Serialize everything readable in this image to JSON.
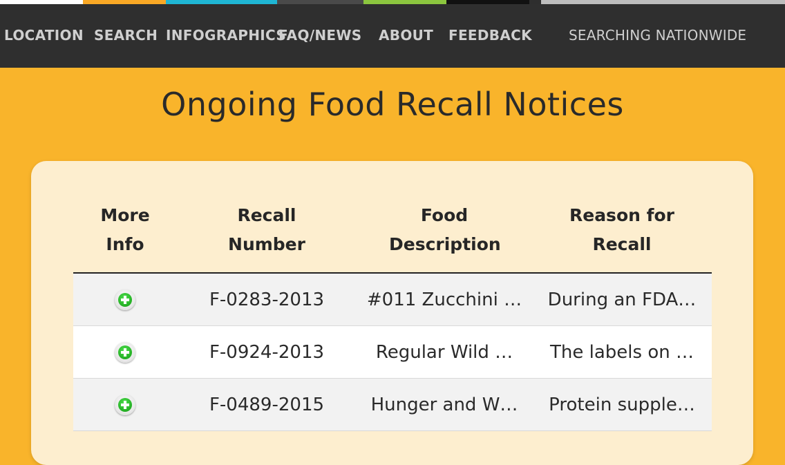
{
  "nav": {
    "location": "LOCATION",
    "search": "SEARCH",
    "infographics": "INFOGRAPHICS",
    "faq_news": "FAQ/NEWS",
    "about": "ABOUT",
    "feedback": "FEEDBACK",
    "search_status": "SEARCHING NATIONWIDE"
  },
  "accent_colors": [
    "#ffffff",
    "#f9a825",
    "#1fb6d4",
    "#4a4a4a",
    "#8cc63f",
    "#111111",
    "#2e2e2e",
    "#bdbdbd"
  ],
  "page": {
    "title": "Ongoing Food Recall Notices"
  },
  "table": {
    "headers": {
      "more_info": "More Info",
      "recall_number": "Recall Number",
      "food_description": "Food Description",
      "reason": "Reason for Recall"
    },
    "rows": [
      {
        "icon": "plus-circle-icon",
        "recall_number": "F-0283-2013",
        "food_description": "#011 Zucchini …",
        "reason": "During an FDA…"
      },
      {
        "icon": "plus-circle-icon",
        "recall_number": "F-0924-2013",
        "food_description": "Regular Wild …",
        "reason": "The labels on …"
      },
      {
        "icon": "plus-circle-icon",
        "recall_number": "F-0489-2015",
        "food_description": "Hunger and W…",
        "reason": "Protein supple…"
      }
    ]
  }
}
